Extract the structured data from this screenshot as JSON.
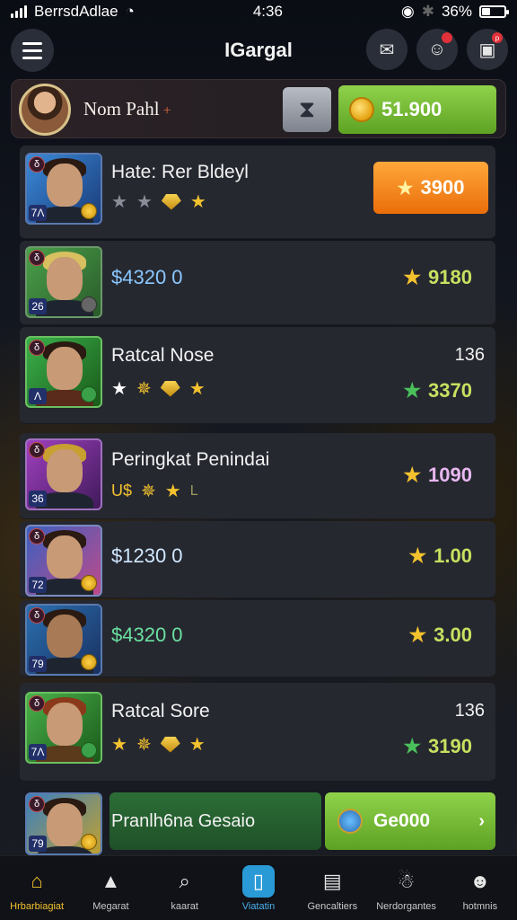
{
  "status": {
    "carrier": "BerrsdAdlae",
    "time": "4:36",
    "battery": "36%",
    "battery_level": 0.36
  },
  "header": {
    "title": "IGargal",
    "menu_icon": "hamburger-icon",
    "icons": [
      "mail-icon",
      "chat-icon",
      "notification-icon"
    ],
    "badge_text": "p"
  },
  "profile": {
    "name": "Nom Pahl",
    "plus": "+",
    "coins": "51.900"
  },
  "rows": [
    {
      "title": "Hate: Rer Bldeyl",
      "rank": "7Λ",
      "type": "δ",
      "button_value": "3900"
    },
    {
      "price": "$4320 0",
      "rank": "26",
      "type": "δ",
      "score": "9180",
      "score_color": "#c8e060"
    },
    {
      "title": "Ratcal Nose",
      "rank": "Λ",
      "type": "δ",
      "top": "136",
      "score": "3370",
      "score_color": "#c8e060"
    },
    {
      "title": "Peringkat Penindai",
      "rank": "36",
      "type": "δ",
      "sub": "U$",
      "sub_tail": "L",
      "score": "1090",
      "score_color": "#e8b8f0"
    },
    {
      "price": "$1230 0",
      "rank": "72",
      "type": "δ",
      "score": "1.00",
      "score_color": "#c8e060"
    },
    {
      "price": "$4320 0",
      "rank": "79",
      "type": "δ",
      "score": "3.00",
      "score_color": "#c8e060"
    },
    {
      "title": "Ratcal Sore",
      "rank": "7Λ",
      "type": "δ",
      "top": "136",
      "score": "3190",
      "score_color": "#c8e060"
    },
    {
      "promo": "Pranlh6na Gesaio",
      "rank": "79",
      "type": "δ",
      "cta": "Ge000"
    }
  ],
  "tabs": [
    {
      "label": "Hrbarbiagiat",
      "icon": "home-icon"
    },
    {
      "label": "Megarat",
      "icon": "cap-icon"
    },
    {
      "label": "kaarat",
      "icon": "search-icon"
    },
    {
      "label": "Viatatin",
      "icon": "phone-icon"
    },
    {
      "label": "Gencaltiers",
      "icon": "bag-icon"
    },
    {
      "label": "Nerdorgantes",
      "icon": "bear-icon"
    },
    {
      "label": "hotmnis",
      "icon": "person-icon"
    }
  ]
}
